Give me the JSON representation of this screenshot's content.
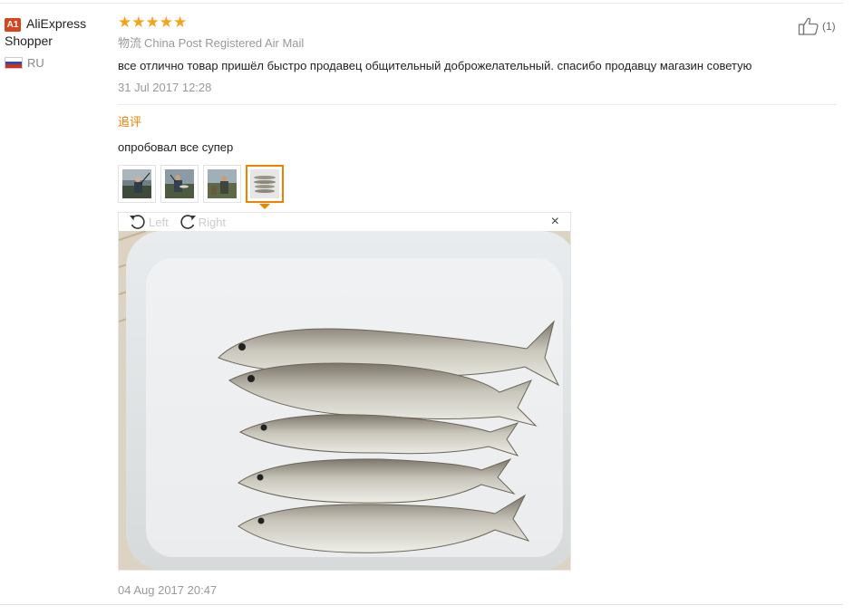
{
  "user": {
    "badge": "A1",
    "name": "AliExpress Shopper",
    "country": "RU",
    "flag_colors": [
      "#ffffff",
      "#2a4fa8",
      "#d52b1e"
    ]
  },
  "review": {
    "stars": "★★★★★",
    "rating_stars": 5,
    "shipping_tag": "物流",
    "shipping_method": "China Post Registered Air Mail",
    "text": "все отлично товар пришёл быстро продавец общительный доброжелательный. спасибо продавцу магазин советую",
    "date": "31 Jul 2017 12:28",
    "helpful_count": "(1)"
  },
  "append": {
    "label": "追评",
    "text": "опробовал все супер",
    "date": "04 Aug 2017 20:47",
    "thumbnails": [
      {
        "icon": "photo-fishing-river"
      },
      {
        "icon": "photo-fishing-catch"
      },
      {
        "icon": "photo-fishing-shore"
      },
      {
        "icon": "photo-fish-tray",
        "active": true
      }
    ]
  },
  "viewer": {
    "rotate_left_label": "Left",
    "rotate_right_label": "Right",
    "close_symbol": "×"
  },
  "colors": {
    "accent": "#f08200",
    "star": "#f7a21c",
    "badge": "#d7451e",
    "muted": "#999999"
  }
}
